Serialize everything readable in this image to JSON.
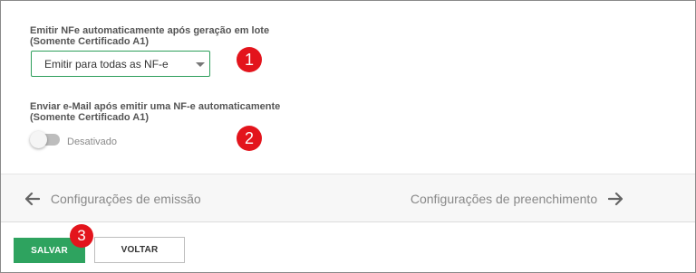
{
  "settings": {
    "auto_emit": {
      "label_line1": "Emitir NFe automaticamente após geração em lote",
      "label_line2": "(Somente Certificado A1)",
      "select_value": "Emitir para todas as NF-e",
      "badge": "1"
    },
    "auto_email": {
      "label_line1": "Enviar e-Mail após emitir uma NF-e automaticamente",
      "label_line2": "(Somente Certificado A1)",
      "toggle_state": "Desativado",
      "toggle_on": false,
      "badge": "2"
    }
  },
  "nav": {
    "prev_label": "Configurações de emissão",
    "next_label": "Configurações de preenchimento"
  },
  "footer": {
    "save_label": "SALVAR",
    "back_label": "VOLTAR",
    "badge": "3"
  },
  "colors": {
    "primary_green": "#2ea35f",
    "badge_red": "#e3141c"
  }
}
